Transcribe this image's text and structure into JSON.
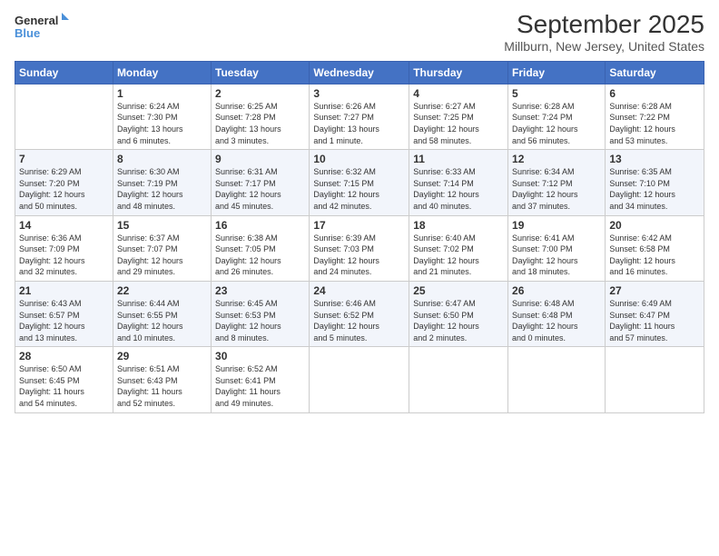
{
  "logo": {
    "line1": "General",
    "line2": "Blue"
  },
  "title": "September 2025",
  "location": "Millburn, New Jersey, United States",
  "days_of_week": [
    "Sunday",
    "Monday",
    "Tuesday",
    "Wednesday",
    "Thursday",
    "Friday",
    "Saturday"
  ],
  "weeks": [
    [
      {
        "day": "",
        "info": ""
      },
      {
        "day": "1",
        "info": "Sunrise: 6:24 AM\nSunset: 7:30 PM\nDaylight: 13 hours\nand 6 minutes."
      },
      {
        "day": "2",
        "info": "Sunrise: 6:25 AM\nSunset: 7:28 PM\nDaylight: 13 hours\nand 3 minutes."
      },
      {
        "day": "3",
        "info": "Sunrise: 6:26 AM\nSunset: 7:27 PM\nDaylight: 13 hours\nand 1 minute."
      },
      {
        "day": "4",
        "info": "Sunrise: 6:27 AM\nSunset: 7:25 PM\nDaylight: 12 hours\nand 58 minutes."
      },
      {
        "day": "5",
        "info": "Sunrise: 6:28 AM\nSunset: 7:24 PM\nDaylight: 12 hours\nand 56 minutes."
      },
      {
        "day": "6",
        "info": "Sunrise: 6:28 AM\nSunset: 7:22 PM\nDaylight: 12 hours\nand 53 minutes."
      }
    ],
    [
      {
        "day": "7",
        "info": "Sunrise: 6:29 AM\nSunset: 7:20 PM\nDaylight: 12 hours\nand 50 minutes."
      },
      {
        "day": "8",
        "info": "Sunrise: 6:30 AM\nSunset: 7:19 PM\nDaylight: 12 hours\nand 48 minutes."
      },
      {
        "day": "9",
        "info": "Sunrise: 6:31 AM\nSunset: 7:17 PM\nDaylight: 12 hours\nand 45 minutes."
      },
      {
        "day": "10",
        "info": "Sunrise: 6:32 AM\nSunset: 7:15 PM\nDaylight: 12 hours\nand 42 minutes."
      },
      {
        "day": "11",
        "info": "Sunrise: 6:33 AM\nSunset: 7:14 PM\nDaylight: 12 hours\nand 40 minutes."
      },
      {
        "day": "12",
        "info": "Sunrise: 6:34 AM\nSunset: 7:12 PM\nDaylight: 12 hours\nand 37 minutes."
      },
      {
        "day": "13",
        "info": "Sunrise: 6:35 AM\nSunset: 7:10 PM\nDaylight: 12 hours\nand 34 minutes."
      }
    ],
    [
      {
        "day": "14",
        "info": "Sunrise: 6:36 AM\nSunset: 7:09 PM\nDaylight: 12 hours\nand 32 minutes."
      },
      {
        "day": "15",
        "info": "Sunrise: 6:37 AM\nSunset: 7:07 PM\nDaylight: 12 hours\nand 29 minutes."
      },
      {
        "day": "16",
        "info": "Sunrise: 6:38 AM\nSunset: 7:05 PM\nDaylight: 12 hours\nand 26 minutes."
      },
      {
        "day": "17",
        "info": "Sunrise: 6:39 AM\nSunset: 7:03 PM\nDaylight: 12 hours\nand 24 minutes."
      },
      {
        "day": "18",
        "info": "Sunrise: 6:40 AM\nSunset: 7:02 PM\nDaylight: 12 hours\nand 21 minutes."
      },
      {
        "day": "19",
        "info": "Sunrise: 6:41 AM\nSunset: 7:00 PM\nDaylight: 12 hours\nand 18 minutes."
      },
      {
        "day": "20",
        "info": "Sunrise: 6:42 AM\nSunset: 6:58 PM\nDaylight: 12 hours\nand 16 minutes."
      }
    ],
    [
      {
        "day": "21",
        "info": "Sunrise: 6:43 AM\nSunset: 6:57 PM\nDaylight: 12 hours\nand 13 minutes."
      },
      {
        "day": "22",
        "info": "Sunrise: 6:44 AM\nSunset: 6:55 PM\nDaylight: 12 hours\nand 10 minutes."
      },
      {
        "day": "23",
        "info": "Sunrise: 6:45 AM\nSunset: 6:53 PM\nDaylight: 12 hours\nand 8 minutes."
      },
      {
        "day": "24",
        "info": "Sunrise: 6:46 AM\nSunset: 6:52 PM\nDaylight: 12 hours\nand 5 minutes."
      },
      {
        "day": "25",
        "info": "Sunrise: 6:47 AM\nSunset: 6:50 PM\nDaylight: 12 hours\nand 2 minutes."
      },
      {
        "day": "26",
        "info": "Sunrise: 6:48 AM\nSunset: 6:48 PM\nDaylight: 12 hours\nand 0 minutes."
      },
      {
        "day": "27",
        "info": "Sunrise: 6:49 AM\nSunset: 6:47 PM\nDaylight: 11 hours\nand 57 minutes."
      }
    ],
    [
      {
        "day": "28",
        "info": "Sunrise: 6:50 AM\nSunset: 6:45 PM\nDaylight: 11 hours\nand 54 minutes."
      },
      {
        "day": "29",
        "info": "Sunrise: 6:51 AM\nSunset: 6:43 PM\nDaylight: 11 hours\nand 52 minutes."
      },
      {
        "day": "30",
        "info": "Sunrise: 6:52 AM\nSunset: 6:41 PM\nDaylight: 11 hours\nand 49 minutes."
      },
      {
        "day": "",
        "info": ""
      },
      {
        "day": "",
        "info": ""
      },
      {
        "day": "",
        "info": ""
      },
      {
        "day": "",
        "info": ""
      }
    ]
  ]
}
